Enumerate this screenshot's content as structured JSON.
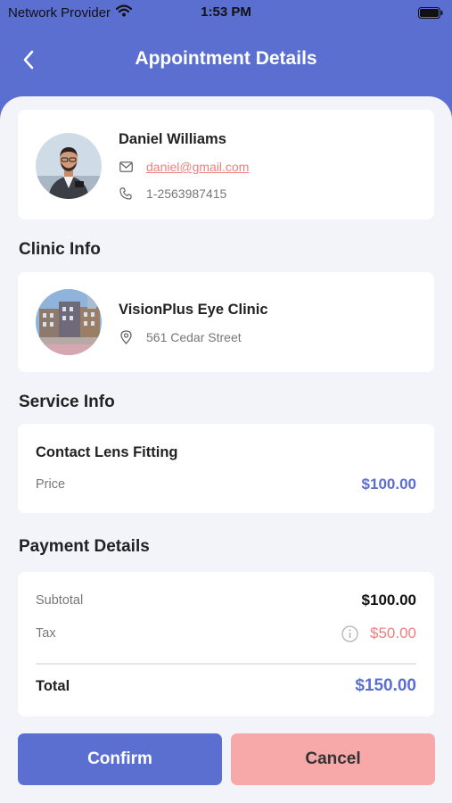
{
  "status_bar": {
    "carrier": "Network Provider",
    "time": "1:53 PM"
  },
  "header": {
    "title": "Appointment Details"
  },
  "patient": {
    "name": "Daniel Williams",
    "email": "daniel@gmail.com",
    "phone": "1-2563987415"
  },
  "clinic_section": {
    "title": "Clinic Info",
    "name": "VisionPlus Eye Clinic",
    "address": "561 Cedar Street"
  },
  "service_section": {
    "title": "Service Info",
    "service_name": "Contact Lens Fitting",
    "price_label": "Price",
    "price_value": "$100.00"
  },
  "payment_section": {
    "title": "Payment Details",
    "subtotal_label": "Subtotal",
    "subtotal_value": "$100.00",
    "tax_label": "Tax",
    "tax_value": "$50.00",
    "total_label": "Total",
    "total_value": "$150.00"
  },
  "actions": {
    "confirm_label": "Confirm",
    "cancel_label": "Cancel"
  },
  "colors": {
    "primary": "#5b6fd1",
    "accent_red": "#ef7f7f",
    "cancel_bg": "#f7a8a8",
    "background": "#f3f4f9"
  },
  "icons": [
    "wifi-icon",
    "battery-icon",
    "back-chevron-icon",
    "mail-icon",
    "phone-icon",
    "location-pin-icon",
    "info-icon"
  ]
}
